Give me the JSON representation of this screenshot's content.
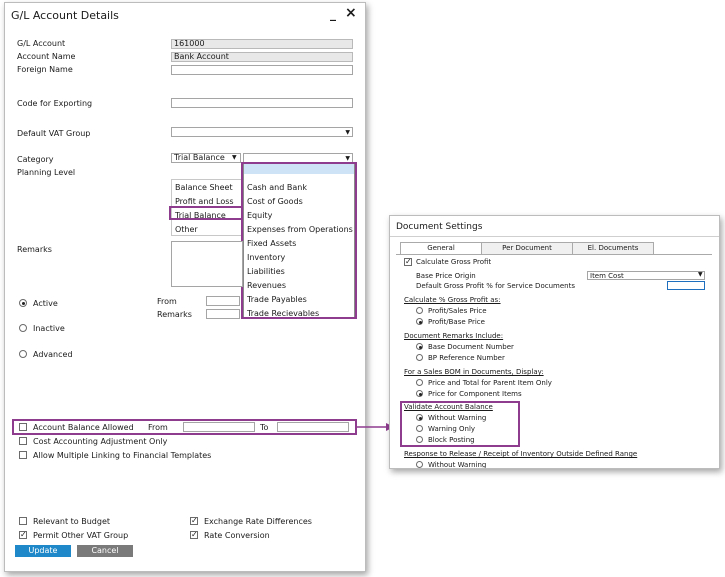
{
  "gl": {
    "title": "G/L Account Details",
    "minimize_glyph": "_",
    "close_glyph": "×",
    "fields": {
      "gl_account_label": "G/L Account",
      "gl_account_value": "161000",
      "account_name_label": "Account Name",
      "account_name_value": "Bank Account",
      "foreign_name_label": "Foreign Name",
      "code_exporting_label": "Code for Exporting",
      "default_vat_label": "Default VAT Group",
      "category_label": "Category",
      "category_value": "Trial Balance",
      "planning_level_label": "Planning Level",
      "remarks_label": "Remarks"
    },
    "category_options": [
      "Balance Sheet",
      "Profit and Loss",
      "Trial Balance",
      "Other"
    ],
    "category_selected": "Trial Balance",
    "subcategory_options": [
      "",
      "Cash and Bank",
      "Cost of Goods",
      "Equity",
      "Expenses from Operations",
      "Fixed Assets",
      "Inventory",
      "Liabilities",
      "Revenues",
      "Trade Payables",
      "Trade Recievables"
    ],
    "status": {
      "active": "Active",
      "inactive": "Inactive",
      "advanced": "Advanced",
      "from_label": "From",
      "remarks_label": "Remarks"
    },
    "checkboxes": {
      "account_balance_allowed": "Account Balance Allowed",
      "from_label": "From",
      "to_label": "To",
      "cost_accounting": "Cost Accounting Adjustment Only",
      "allow_multiple_linking": "Allow Multiple Linking to Financial Templates",
      "relevant_to_budget": "Relevant to Budget",
      "permit_other_vat": "Permit Other VAT Group",
      "exchange_rate_diff": "Exchange Rate Differences",
      "rate_conversion": "Rate Conversion"
    },
    "buttons": {
      "update": "Update",
      "cancel": "Cancel"
    }
  },
  "doc": {
    "title": "Document Settings",
    "tabs": [
      "General",
      "Per Document",
      "El. Documents"
    ],
    "calc_gross_profit": "Calculate Gross Profit",
    "base_price_origin_label": "Base Price Origin",
    "base_price_origin_value": "Item Cost",
    "default_gp_label": "Default Gross Profit % for Service Documents",
    "calc_gp_as_header": "Calculate % Gross Profit as:",
    "calc_gp_options": [
      "Profit/Sales Price",
      "Profit/Base Price"
    ],
    "remarks_include_header": "Document Remarks Include:",
    "remarks_include_options": [
      "Base Document Number",
      "BP Reference Number"
    ],
    "sales_bom_header": "For a Sales BOM in Documents, Display:",
    "sales_bom_options": [
      "Price and Total for Parent Item Only",
      "Price for Component Items"
    ],
    "validate_header": "Validate Account Balance",
    "validate_options": [
      "Without Warning",
      "Warning Only",
      "Block Posting"
    ],
    "response_header": "Response to Release / Receipt of Inventory Outside Defined Range",
    "response_options": [
      "Without Warning"
    ]
  },
  "colors": {
    "highlight": "#8e3c8e",
    "accent": "#1f6fbf",
    "update_button": "#1e88c8",
    "cancel_button": "#7a7a7a"
  }
}
